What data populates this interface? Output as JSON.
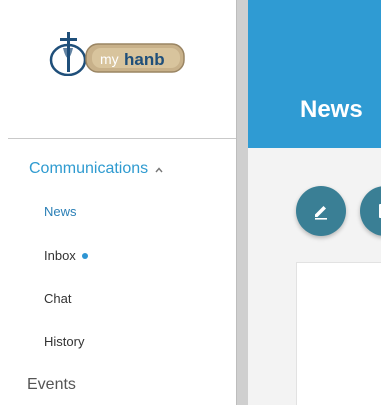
{
  "logo": {
    "brand_prefix": "my",
    "brand_name": "hanb"
  },
  "sidebar": {
    "section_label": "Communications",
    "section_expanded": true,
    "items": [
      {
        "label": "News",
        "active": true
      },
      {
        "label": "Inbox",
        "unread": true
      },
      {
        "label": "Chat"
      },
      {
        "label": "History"
      }
    ],
    "next_section_label": "Events"
  },
  "main": {
    "title": "News",
    "actions": [
      {
        "icon": "pencil-icon"
      },
      {
        "icon": "document-icon"
      }
    ]
  },
  "colors": {
    "accent": "#2f9bd3",
    "fab": "#3a7f95",
    "active_link": "#2a7fb6",
    "unread_dot": "#2e95d3"
  }
}
